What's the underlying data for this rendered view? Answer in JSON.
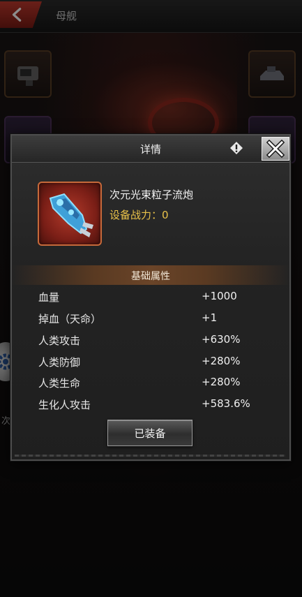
{
  "top_bar": {
    "title": "母舰"
  },
  "side_text": "次",
  "dialog": {
    "title": "详情",
    "item": {
      "name": "次元光束粒子流炮",
      "power_label": "设备战力：",
      "power_value": "0"
    },
    "section_title": "基础属性",
    "stats": [
      {
        "name": "血量",
        "value": "+1000"
      },
      {
        "name": "掉血（天命）",
        "value": "+1"
      },
      {
        "name": "人类攻击",
        "value": "+630%"
      },
      {
        "name": "人类防御",
        "value": "+280%"
      },
      {
        "name": "人类生命",
        "value": "+280%"
      },
      {
        "name": "生化人攻击",
        "value": "+583.6%"
      }
    ],
    "equip_button": "已装备"
  },
  "colors": {
    "accent_power": "#e9c24a",
    "back_button": "#c13a2e",
    "item_frame": "#c7693a"
  },
  "icons": [
    "back-arrow-icon",
    "info-icon",
    "close-x-icon",
    "gear-icon",
    "cannon-icon"
  ]
}
